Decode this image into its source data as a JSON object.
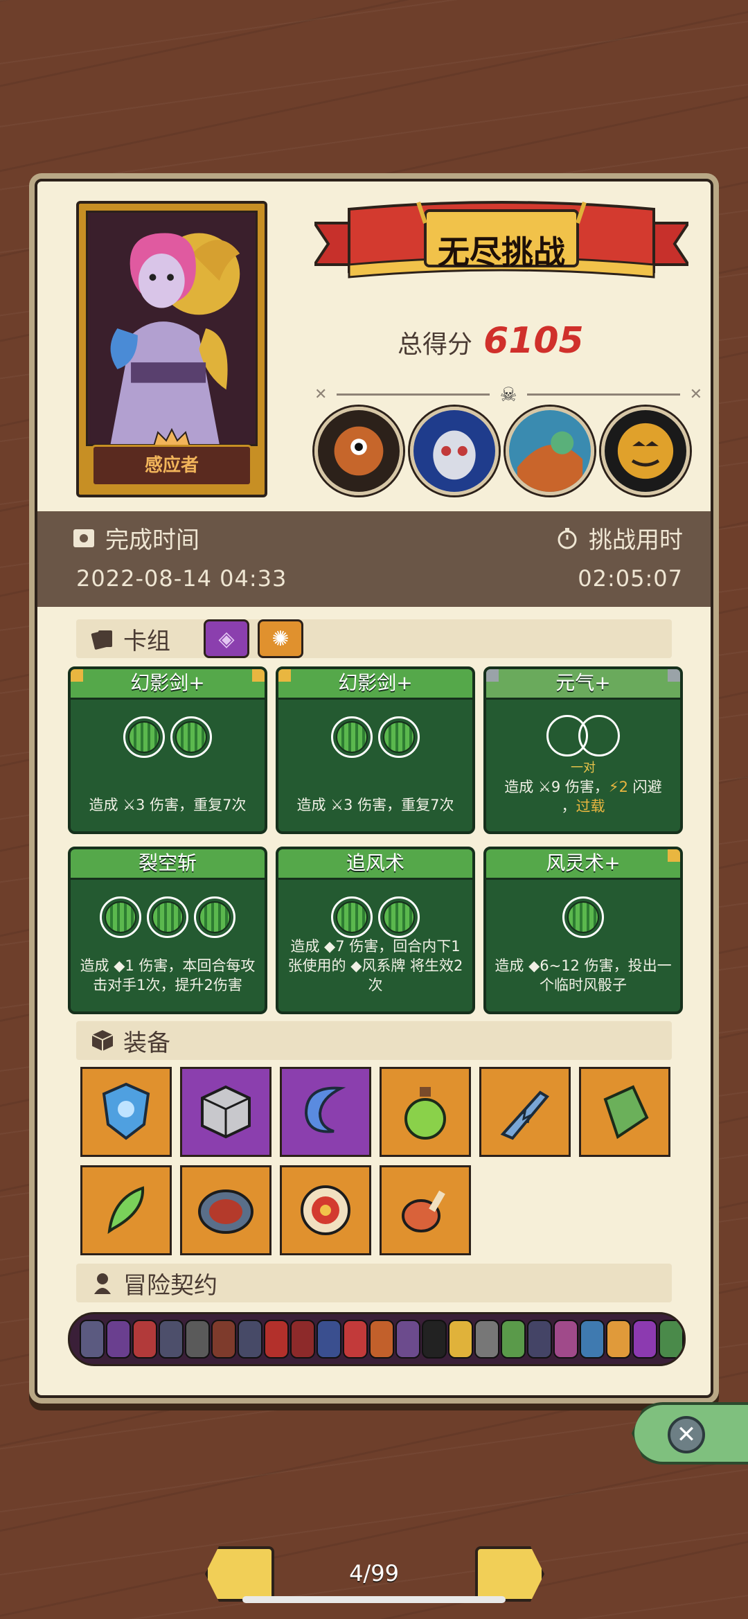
{
  "header": {
    "banner_title": "无尽挑战",
    "score_label": "总得分",
    "score_value": "6105",
    "character_name": "感应者"
  },
  "info": {
    "finish_time_label": "完成时间",
    "finish_time_value": "2022-08-14 04:33",
    "duration_label": "挑战用时",
    "duration_value": "02:05:07"
  },
  "sections": {
    "deck": "卡组",
    "equipment": "装备",
    "contracts": "冒险契约"
  },
  "cards": [
    {
      "title": "幻影剑+",
      "orbs": 2,
      "desc_a": "造成 ",
      "desc_b": "3",
      "desc_c": " 伤害，重复7次"
    },
    {
      "title": "幻影剑+",
      "orbs": 2,
      "desc_a": "造成 ",
      "desc_b": "3",
      "desc_c": " 伤害，重复7次"
    },
    {
      "title": "元气+",
      "orbs": 0,
      "pair_label": "一对",
      "desc_a": "造成 ",
      "desc_b": "9",
      "desc_c": " 伤害，",
      "desc_d": "2",
      "desc_e": " 闪避",
      "desc_f": "，",
      "desc_g": "过载"
    },
    {
      "title": "裂空斩",
      "orbs": 3,
      "desc": "造成 ◆1 伤害，本回合每攻击对手1次，提升2伤害"
    },
    {
      "title": "追风术",
      "orbs": 2,
      "desc": "造成 ◆7 伤害，回合内下1张使用的 ◆风系牌 将生效2次"
    },
    {
      "title": "风灵术+",
      "orbs": 1,
      "desc": "造成 ◆6~12 伤害，投出一个临时风骰子"
    }
  ],
  "equipment": [
    {
      "icon": "shield-icon",
      "color": "orange"
    },
    {
      "icon": "cube-icon",
      "color": "purple"
    },
    {
      "icon": "hook-icon",
      "color": "purple"
    },
    {
      "icon": "potion-icon",
      "color": "orange"
    },
    {
      "icon": "sword-icon",
      "color": "orange"
    },
    {
      "icon": "stone-icon",
      "color": "orange"
    },
    {
      "icon": "feather-icon",
      "color": "orange"
    },
    {
      "icon": "wheel-icon",
      "color": "orange"
    },
    {
      "icon": "medal-icon",
      "color": "orange"
    },
    {
      "icon": "meat-icon",
      "color": "orange"
    }
  ],
  "contract_colors": [
    "#5b5a80",
    "#6a3f8f",
    "#b23a3a",
    "#4d4f6b",
    "#5a5a5a",
    "#7e3b2c",
    "#474a67",
    "#b3302b",
    "#8d2a2a",
    "#3a4f8f",
    "#c23a3a",
    "#c2602b",
    "#6c4b8d",
    "#222222",
    "#e0b23a",
    "#777777",
    "#5a9a4a",
    "#444466",
    "#a04a8a",
    "#3f7ab0",
    "#e09a3a",
    "#8c3ab0",
    "#4a8a4a",
    "#b0306a"
  ],
  "pager": {
    "label": "4/99"
  },
  "colors": {
    "accent": "#d0302b",
    "card_green": "#245a31",
    "panel": "#f6efd8"
  }
}
